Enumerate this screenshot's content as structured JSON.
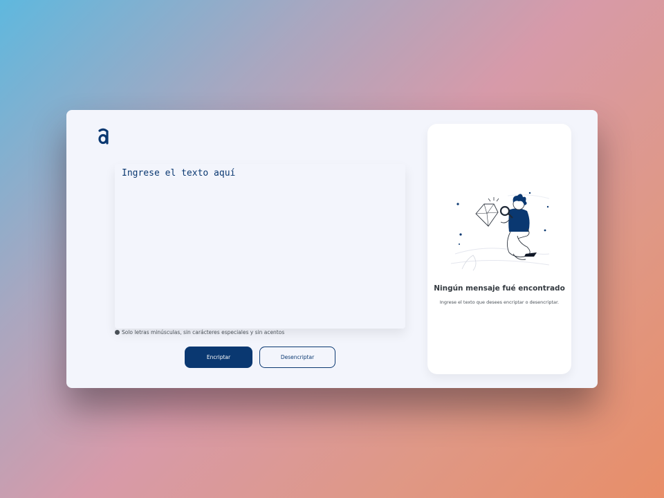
{
  "logo": {
    "icon": "alura-logo-icon",
    "color": "#0a3871"
  },
  "input": {
    "placeholder": "Ingrese el texto aquí",
    "value": ""
  },
  "hint": {
    "icon": "info-icon",
    "text": "Solo letras minúsculas, sin carácteres especiales y sin acentos"
  },
  "buttons": {
    "encrypt_label": "Encriptar",
    "decrypt_label": "Desencriptar"
  },
  "output_panel": {
    "illustration": "person-magnifying-glass-diamond-illustration",
    "title": "Ningún mensaje fué encontrado",
    "subtitle": "Ingrese el texto que desees encriptar o desencriptar."
  },
  "colors": {
    "primary": "#0a3871",
    "card_background": "#f3f5fc",
    "panel_background": "#ffffff",
    "text_dark": "#343a40",
    "text_muted": "#495057"
  }
}
